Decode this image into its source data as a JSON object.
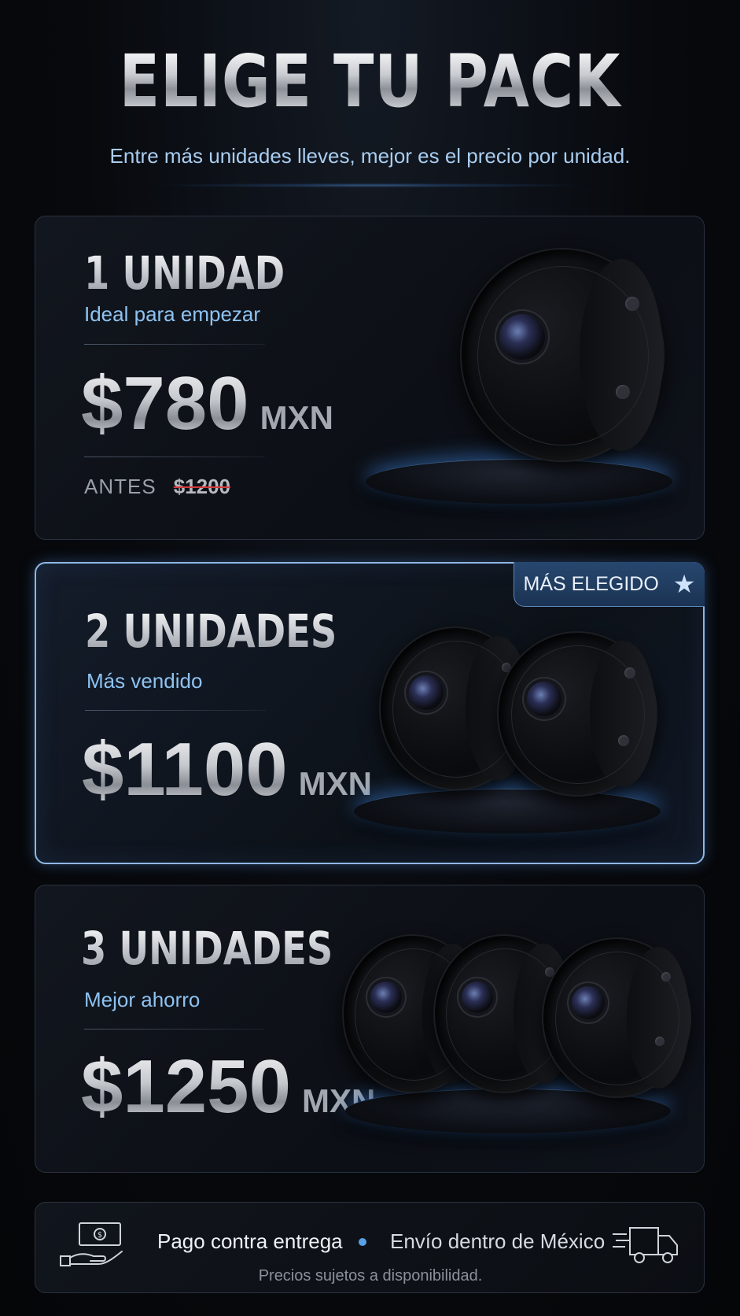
{
  "header": {
    "title": "ELIGE TU PACK",
    "subtitle": "Entre más unidades lleves, mejor es el precio por unidad."
  },
  "packs": [
    {
      "title": "1 UNIDAD",
      "subtitle": "Ideal para empezar",
      "price": "$780",
      "currency": "MXN",
      "before_label": "ANTES",
      "before_price": "$1200",
      "cameras": 1
    },
    {
      "title": "2 UNIDADES",
      "subtitle": "Más vendido",
      "price": "$1100",
      "currency": "MXN",
      "badge": "MÁS ELEGIDO",
      "badge_icon": "star-icon",
      "cameras": 2
    },
    {
      "title": "3 UNIDADES",
      "subtitle": "Mejor ahorro",
      "price": "$1250",
      "currency": "MXN",
      "cameras": 3
    }
  ],
  "footer": {
    "payment": "Pago contra entrega",
    "shipping": "Envío dentro de México",
    "note": "Precios sujetos a disponibilidad.",
    "payment_icon": "cash-hand-icon",
    "shipping_icon": "delivery-truck-icon"
  },
  "colors": {
    "accent_blue": "#8ec3f2",
    "badge_bg": "#1f3a5e",
    "background": "#07090d",
    "strike": "#d23a3a"
  }
}
